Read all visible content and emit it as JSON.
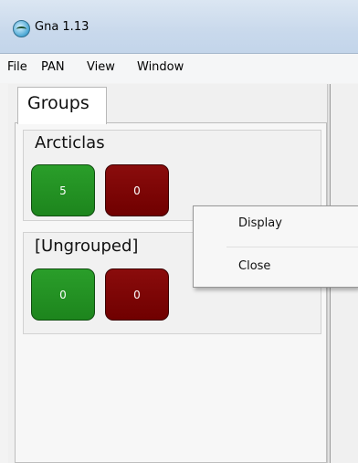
{
  "window": {
    "title": "Gna 1.13"
  },
  "menu": {
    "items": [
      "File",
      "PAN",
      "View",
      "Window"
    ]
  },
  "tabs": [
    {
      "label": "Groups",
      "active": true
    }
  ],
  "groups": [
    {
      "name": "Arcticlas",
      "counters": [
        {
          "value": "5",
          "color": "#2a9e2a"
        },
        {
          "value": "0",
          "color": "#8a0c0c"
        }
      ]
    },
    {
      "name": "[Ungrouped]",
      "counters": [
        {
          "value": "0",
          "color": "#2a9e2a"
        },
        {
          "value": "0",
          "color": "#8a0c0c"
        }
      ]
    }
  ],
  "context_menu": {
    "items": [
      "Display",
      "Close"
    ]
  }
}
